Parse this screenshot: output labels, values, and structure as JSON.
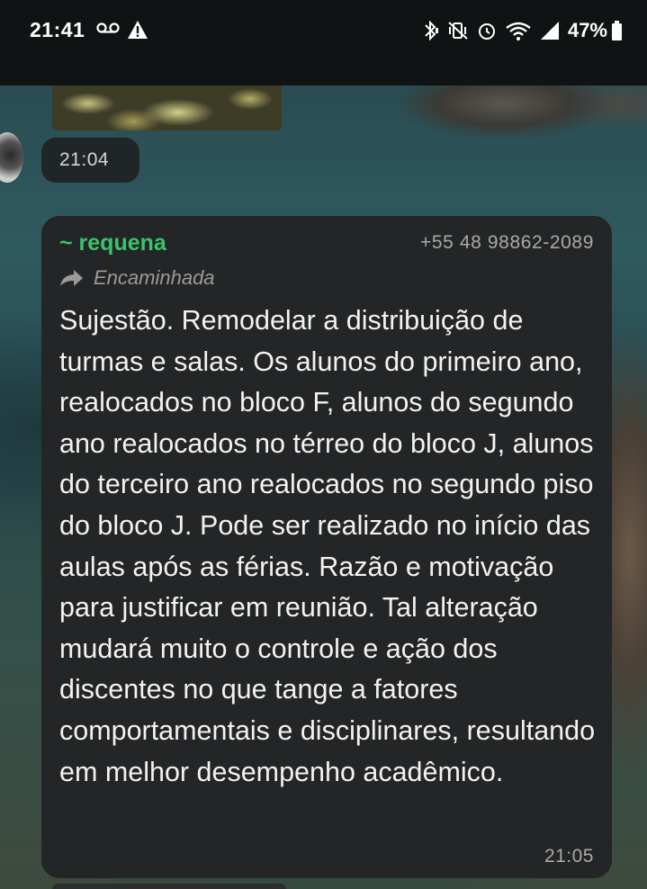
{
  "status_bar": {
    "time": "21:41",
    "battery_percent": "47%",
    "left_icons": [
      "voicemail-icon",
      "warning-icon"
    ],
    "right_icons": [
      "bluetooth-icon",
      "vibrate-icon",
      "alarm-icon",
      "wifi-icon",
      "signal-icon",
      "battery-icon"
    ]
  },
  "chat": {
    "previous_message_time": "21:04",
    "message": {
      "sender": "~ requena",
      "sender_color": "#3bc36c",
      "phone": "+55 48 98862-2089",
      "forwarded_label": "Encaminhada",
      "text": "Sujestão. Remodelar a distribuição de turmas e salas. Os alunos do primeiro ano, realocados no bloco F, alunos do segundo ano realocados no térreo do bloco J, alunos do terceiro ano realocados no segundo piso do bloco J. Pode ser realizado no início das aulas após as férias. Razão e motivação para justificar em reunião. Tal alteração mudará muito o controle e ação dos discentes no que tange a fatores comportamentais e disciplinares, resultando em melhor desempenho acadêmico.",
      "time": "21:05"
    }
  }
}
